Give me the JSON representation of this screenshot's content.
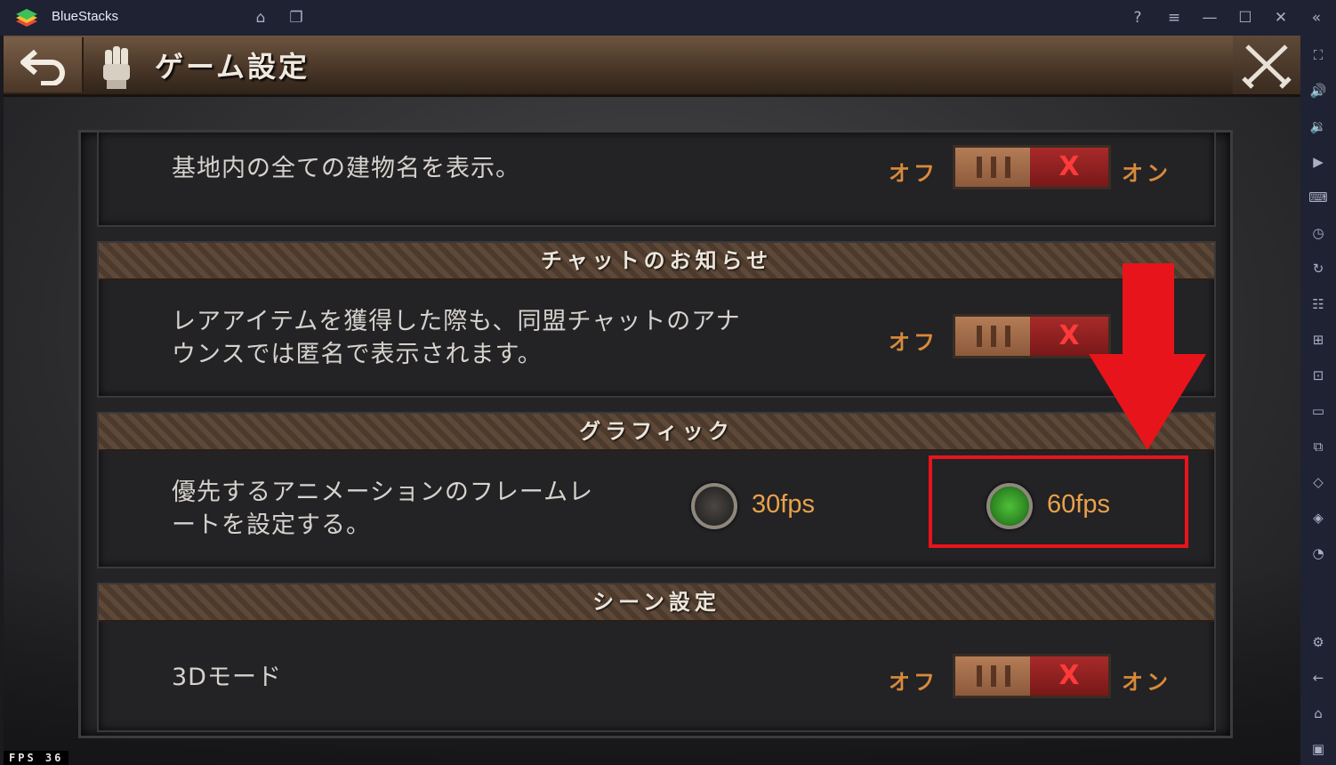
{
  "window": {
    "app_name": "BlueStacks",
    "icons": [
      "home-icon",
      "multi-instance-icon",
      "help-icon",
      "menu-icon",
      "minimize-icon",
      "maximize-icon",
      "close-icon",
      "collapse-sidebar-icon"
    ]
  },
  "sidebar": {
    "items": [
      "fullscreen-icon",
      "volume-up-icon",
      "volume-down-icon",
      "media-icon",
      "keyboard-icon",
      "macro-icon",
      "sync-icon",
      "controls-icon",
      "apk-icon",
      "screenshot-icon",
      "folder-icon",
      "multi-instance-icon",
      "eco-mode-icon",
      "layers-icon",
      "performance-icon",
      "settings-icon",
      "back-icon",
      "home-icon",
      "recent-apps-icon"
    ]
  },
  "game": {
    "page_title": "ゲーム設定",
    "rows": [
      {
        "description": "基地内の全ての建物名を表示。",
        "off_label": "オフ",
        "on_label": "オン",
        "toggle_symbol": "X"
      },
      {
        "section_title": "チャットのお知らせ",
        "description_line1": "レアアイテムを獲得した際も、同盟チャットのアナ",
        "description_line2": "ウンスでは匿名で表示されます。",
        "off_label": "オフ",
        "toggle_symbol": "X"
      },
      {
        "section_title": "グラフィック",
        "description_line1": "優先するアニメーションのフレームレ",
        "description_line2": "ートを設定する。",
        "options": [
          {
            "label": "30fps",
            "selected": false
          },
          {
            "label": "60fps",
            "selected": true
          }
        ]
      },
      {
        "section_title": "シーン設定",
        "description": "3Dモード",
        "off_label": "オフ",
        "on_label": "オン",
        "toggle_symbol": "X"
      }
    ],
    "fps_counter": "FPS  36"
  },
  "colors": {
    "accent_orange": "#d98a3a",
    "annotation_red": "#e8141b",
    "selected_green": "#4fbf3a"
  }
}
